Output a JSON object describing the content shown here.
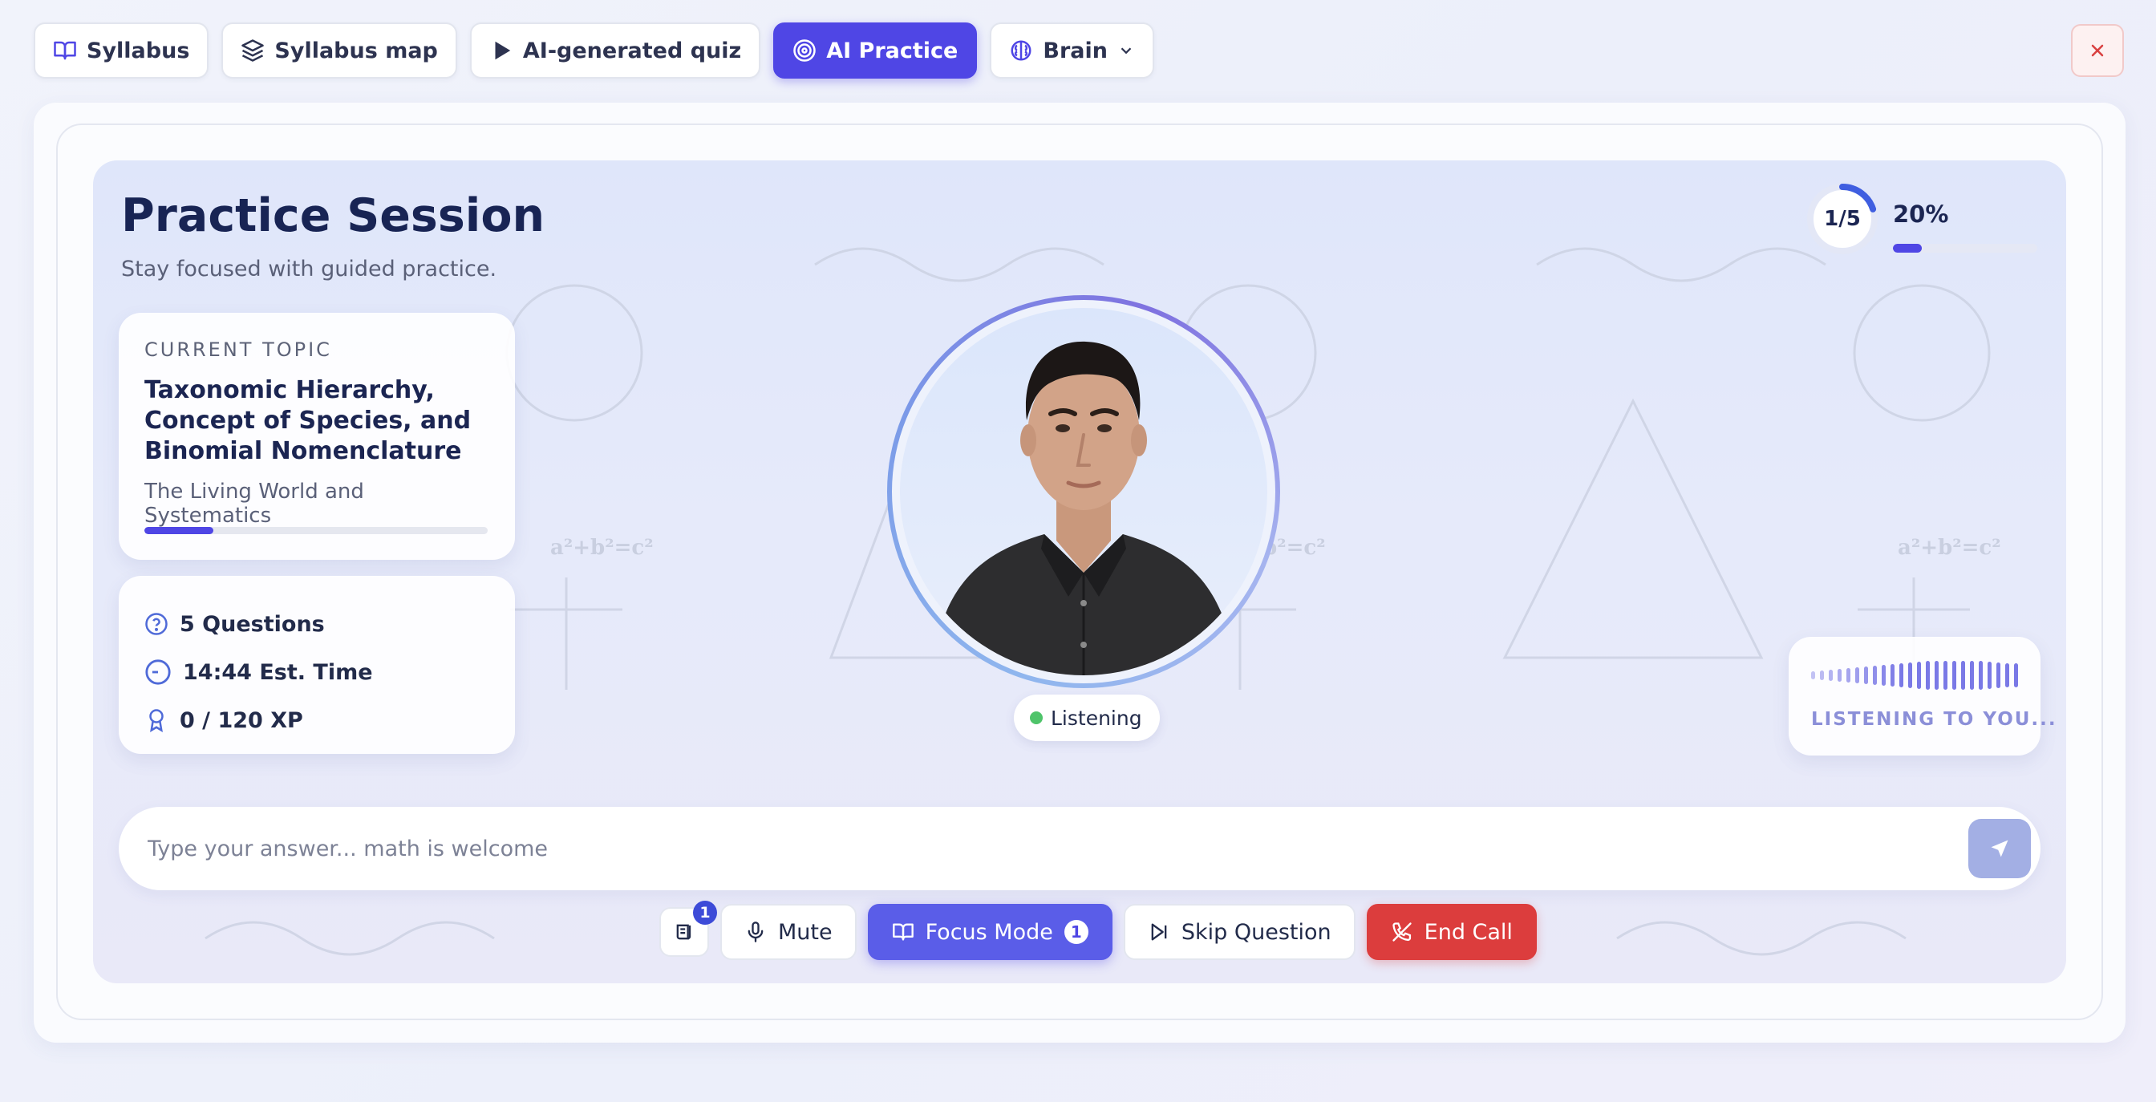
{
  "nav": {
    "tabs": [
      {
        "label": "Syllabus",
        "icon": "book-icon"
      },
      {
        "label": "Syllabus map",
        "icon": "layers-icon"
      },
      {
        "label": "AI-generated quiz",
        "icon": "play-icon"
      },
      {
        "label": "AI Practice",
        "icon": "target-icon",
        "active": true
      },
      {
        "label": "Brain",
        "icon": "brain-icon"
      }
    ]
  },
  "session": {
    "title": "Practice Session",
    "subtitle": "Stay focused with guided practice."
  },
  "topic": {
    "kicker": "CURRENT TOPIC",
    "title": "Taxonomic Hierarchy, Concept of Species, and Binomial Nomenclature",
    "chapter": "The Living World and Systematics",
    "progress": 0.2
  },
  "stats": {
    "questions": "5 Questions",
    "time": "14:44 Est. Time",
    "xp": "0 / 120 XP"
  },
  "decor": {
    "formula": "a²+b²=c²"
  },
  "progress": {
    "counter": "1/5",
    "percent_label": "20%",
    "fraction": 0.2
  },
  "avatar": {
    "status": "Listening"
  },
  "voice": {
    "label": "LISTENING TO YOU..."
  },
  "answer": {
    "placeholder": "Type your answer... math is welcome"
  },
  "controls": {
    "notes_badge": "1",
    "mute": "Mute",
    "focus": "Focus Mode",
    "focus_badge": "1",
    "skip": "Skip Question",
    "end": "End Call"
  },
  "colors": {
    "accent": "#4f46e5",
    "danger": "#dc3d3d",
    "success": "#4fc46a"
  }
}
